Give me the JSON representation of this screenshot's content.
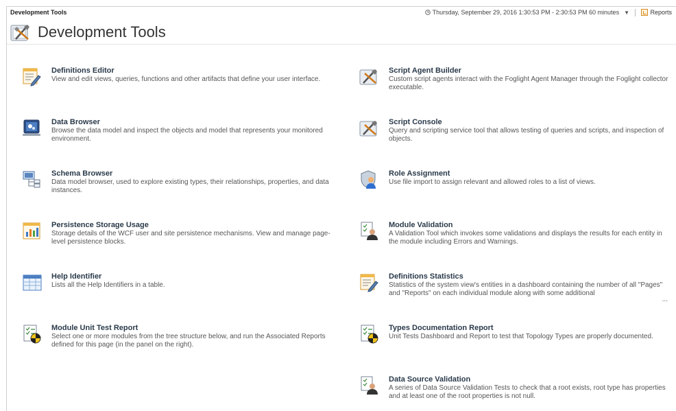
{
  "topbar": {
    "breadcrumb": "Development Tools",
    "time_range": "Thursday, September 29, 2016 1:30:53 PM - 2:30:53 PM 60 minutes",
    "time_icon": "clock-icon",
    "reports_label": "Reports"
  },
  "header": {
    "title": "Development Tools",
    "icon": "dev-tools-icon"
  },
  "tools_left": [
    {
      "name": "Definitions Editor",
      "desc": "View and edit views, queries, functions and other artifacts that define your user interface.",
      "icon": "definitions-editor-icon"
    },
    {
      "name": "Data Browser",
      "desc": "Browse the data model and inspect the objects and model that represents your monitored environment.",
      "icon": "data-browser-icon"
    },
    {
      "name": "Schema Browser",
      "desc": "Data model browser, used to explore existing types, their relationships, properties, and data instances.",
      "icon": "schema-browser-icon"
    },
    {
      "name": "Persistence Storage Usage",
      "desc": "Storage details of the WCF user and site persistence mechanisms. View and manage page-level persistence blocks.",
      "icon": "storage-chart-icon"
    },
    {
      "name": "Help Identifier",
      "desc": "Lists all the Help Identifiers in a table.",
      "icon": "table-icon"
    },
    {
      "name": "Module Unit Test Report",
      "desc": "Select one or more modules from the tree structure below, and run the Associated Reports defined for this page (in the panel on the right).",
      "icon": "unit-test-report-icon"
    }
  ],
  "tools_right": [
    {
      "name": "Script Agent Builder",
      "desc": "Custom script agents interact with the Foglight Agent Manager through the Foglight collector executable.",
      "icon": "script-agent-builder-icon"
    },
    {
      "name": "Script Console",
      "desc": "Query and scripting service tool that allows testing of queries and scripts, and inspection of objects.",
      "icon": "script-console-icon"
    },
    {
      "name": "Role Assignment",
      "desc": "Use file import to assign relevant and allowed roles to a list of views.",
      "icon": "role-assignment-icon"
    },
    {
      "name": "Module Validation",
      "desc": "A Validation Tool which invokes some validations and displays the results for each entity in the module including Errors and Warnings.",
      "icon": "module-validation-icon"
    },
    {
      "name": "Definitions Statistics",
      "desc": "Statistics of the system view's entities in a dashboard containing the number of all \"Pages\" and \"Reports\" on each individual module along with some additional",
      "icon": "definitions-statistics-icon"
    },
    {
      "name": "Types Documentation Report",
      "desc": "Unit Tests Dashboard and Report to test that Topology Types are properly documented.",
      "icon": "types-doc-report-icon"
    },
    {
      "name": "Data Source Validation",
      "desc": "A series of Data Source Validation Tests to check that a root exists, root type has properties and at least one of the root properties is not null.",
      "icon": "data-source-validation-icon"
    }
  ],
  "more_indicator": "..."
}
